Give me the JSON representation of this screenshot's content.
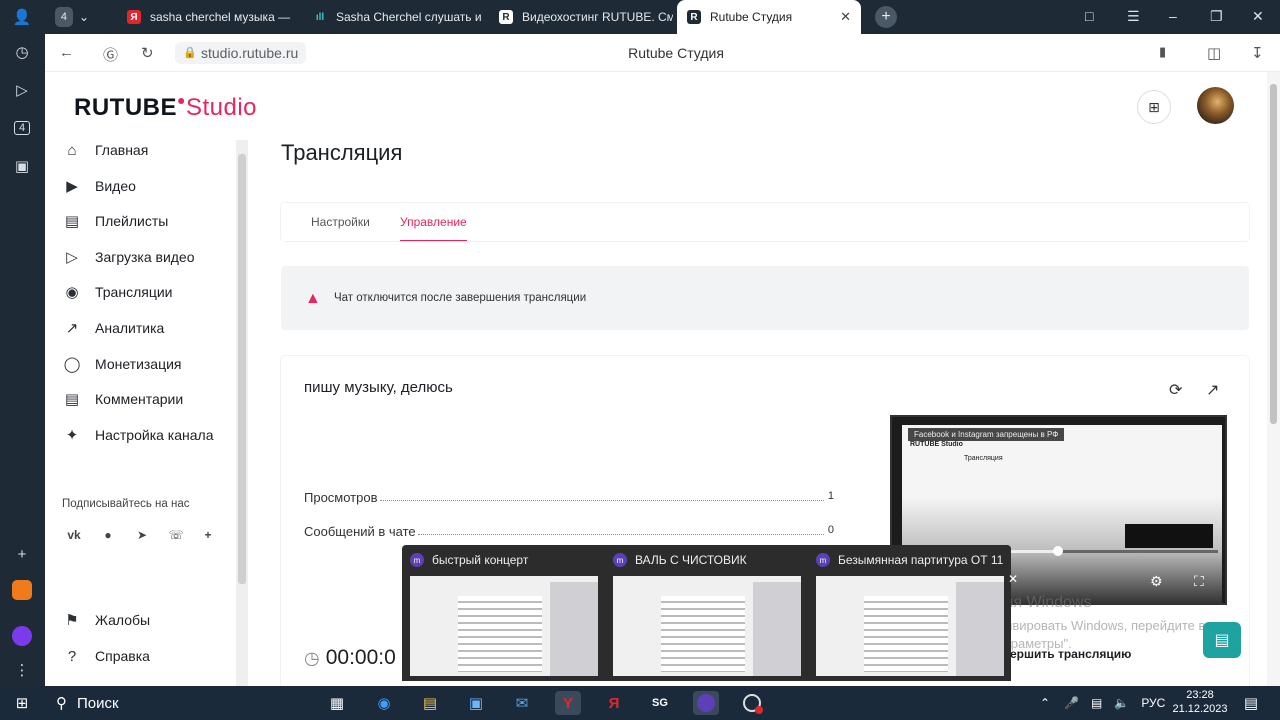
{
  "browser": {
    "tab_counter": "4",
    "tabs": [
      {
        "label": "sasha cherchel музыка —",
        "fav": "Я"
      },
      {
        "label": "Sasha Cherchel слушать и",
        "fav": "ıll"
      },
      {
        "label": "Видеохостинг RUTUBE. См",
        "fav": "R"
      },
      {
        "label": "Rutube Студия",
        "fav": "R"
      }
    ],
    "url": "studio.rutube.ru",
    "page_title": "Rutube Студия"
  },
  "logo": {
    "main": "RUTUBE",
    "suffix": "Studio"
  },
  "nav": [
    "Главная",
    "Видео",
    "Плейлисты",
    "Загрузка видео",
    "Трансляции",
    "Аналитика",
    "Монетизация",
    "Комментарии",
    "Настройка канала"
  ],
  "social": {
    "title": "Подписывайтесь на нас"
  },
  "nav_bottom": [
    "Жалобы",
    "Справка"
  ],
  "content": {
    "title": "Трансляция",
    "tabs": [
      "Настройки",
      "Управление"
    ],
    "notice": "Чат отключится после завершения трансляции",
    "stream_name": "пишу музыку, делюсь",
    "stats": [
      {
        "label": "Просмотров",
        "value": "1"
      },
      {
        "label": "Сообщений в чате",
        "value": "0"
      }
    ],
    "timer": "00:00:0",
    "end_stream_label": "ершить трансляцию"
  },
  "preview": {
    "banner": "Facebook и Instagram запрещены в РФ",
    "mini_logo": "RUTUBE Studio",
    "mini_title": "Трансляция",
    "progress": 0.48
  },
  "activation": {
    "title": "Активация Windows",
    "sub": "Чтобы активировать Windows, перейдите в раздел \"Параметры\"."
  },
  "thumbnails": [
    {
      "title": "быстрый концерт"
    },
    {
      "title": "ВАЛЬ С ЧИСТОВИК"
    },
    {
      "title": "Безымянная партитура ОТ 11 ..."
    }
  ],
  "taskbar": {
    "search": "Поиск",
    "lang": "РУС",
    "time": "23:28",
    "date": "21.12.2023"
  },
  "colors": {
    "accent": "#e8265d",
    "chat_fab": "#1ea3a0",
    "browser_chrome": "#1e2a35",
    "taskbar": "#1b2a3a"
  }
}
